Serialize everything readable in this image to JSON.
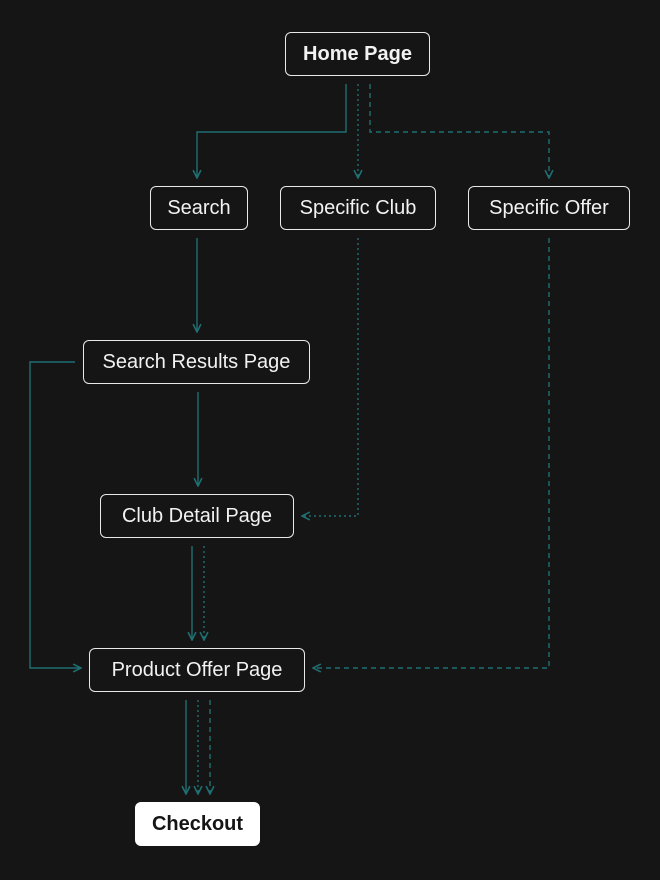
{
  "diagram": {
    "colors": {
      "background": "#151515",
      "node_border": "#e9e9e9",
      "node_text": "#f2f2f2",
      "edge": "#1f6f73",
      "checkout_fill": "#ffffff",
      "checkout_text": "#151515"
    },
    "nodes": {
      "home": "Home Page",
      "search": "Search",
      "specific_club": "Specific Club",
      "specific_offer": "Specific Offer",
      "search_results": "Search Results Page",
      "club_detail": "Club Detail Page",
      "product_offer": "Product Offer Page",
      "checkout": "Checkout"
    },
    "edges": [
      {
        "from": "home",
        "to": "search",
        "style": "solid"
      },
      {
        "from": "home",
        "to": "specific_club",
        "style": "dotted"
      },
      {
        "from": "home",
        "to": "specific_offer",
        "style": "dashed"
      },
      {
        "from": "search",
        "to": "search_results",
        "style": "solid"
      },
      {
        "from": "specific_club",
        "to": "club_detail",
        "style": "dotted"
      },
      {
        "from": "specific_offer",
        "to": "product_offer",
        "style": "dashed"
      },
      {
        "from": "search_results",
        "to": "club_detail",
        "style": "solid"
      },
      {
        "from": "search_results",
        "to": "product_offer",
        "style": "solid"
      },
      {
        "from": "club_detail",
        "to": "product_offer",
        "style": "solid"
      },
      {
        "from": "club_detail",
        "to": "product_offer",
        "style": "dotted"
      },
      {
        "from": "product_offer",
        "to": "checkout",
        "style": "solid"
      },
      {
        "from": "product_offer",
        "to": "checkout",
        "style": "dotted"
      },
      {
        "from": "product_offer",
        "to": "checkout",
        "style": "dashed"
      }
    ]
  }
}
